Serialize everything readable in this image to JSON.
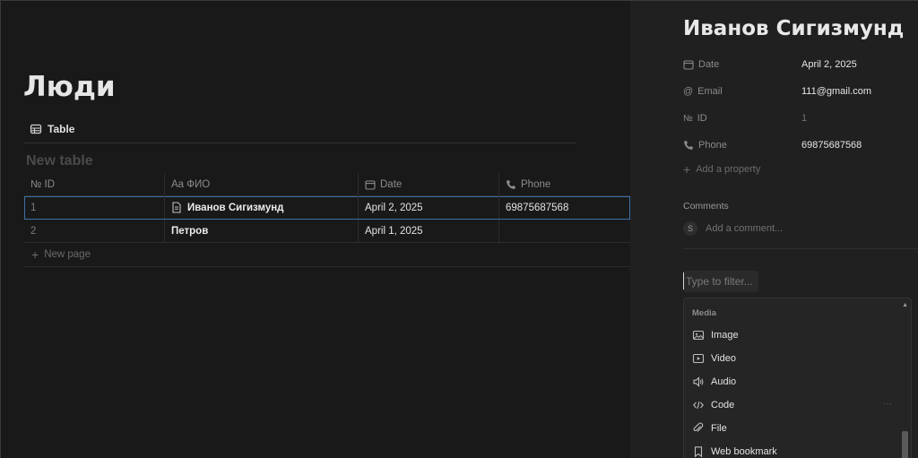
{
  "database": {
    "page_title": "Люди",
    "view_tab_label": "Table",
    "table_title": "New table",
    "columns": [
      {
        "label": "№ ID",
        "icon": "number-icon"
      },
      {
        "label": "Aa ФИО",
        "icon": ""
      },
      {
        "label": "Date",
        "icon": "calendar-icon"
      },
      {
        "label": "Phone",
        "icon": "phone-icon"
      }
    ],
    "rows": [
      {
        "id": "1",
        "name": "Иванов Сигизмунд",
        "date": "April 2, 2025",
        "phone": "69875687568"
      },
      {
        "id": "2",
        "name": "Петров",
        "date": "April 1, 2025",
        "phone": ""
      }
    ],
    "new_page_label": "New page"
  },
  "peek": {
    "title": "Иванов Сигизмунд",
    "properties": [
      {
        "name": "Date",
        "icon": "calendar-icon",
        "value": "April 2, 2025"
      },
      {
        "name": "Email",
        "icon": "at-icon",
        "value": "111@gmail.com"
      },
      {
        "name": "ID",
        "icon": "number-icon",
        "value": "1"
      },
      {
        "name": "Phone",
        "icon": "phone-icon",
        "value": "69875687568"
      }
    ],
    "add_property_label": "Add a property",
    "comments_label": "Comments",
    "comment_avatar_letter": "S",
    "add_comment_placeholder": "Add a comment..."
  },
  "block_menu": {
    "filter_placeholder": "Type to filter...",
    "section_title": "Media",
    "items": [
      {
        "label": "Image",
        "icon": "image-icon"
      },
      {
        "label": "Video",
        "icon": "video-icon"
      },
      {
        "label": "Audio",
        "icon": "audio-icon"
      },
      {
        "label": "Code",
        "icon": "code-icon"
      },
      {
        "label": "File",
        "icon": "paperclip-icon"
      },
      {
        "label": "Web bookmark",
        "icon": "bookmark-icon"
      }
    ],
    "more_glyph": "···"
  },
  "colors": {
    "background": "#191919",
    "panel": "#202020",
    "menu": "#252525",
    "selection_outline": "#3d6fa8"
  }
}
